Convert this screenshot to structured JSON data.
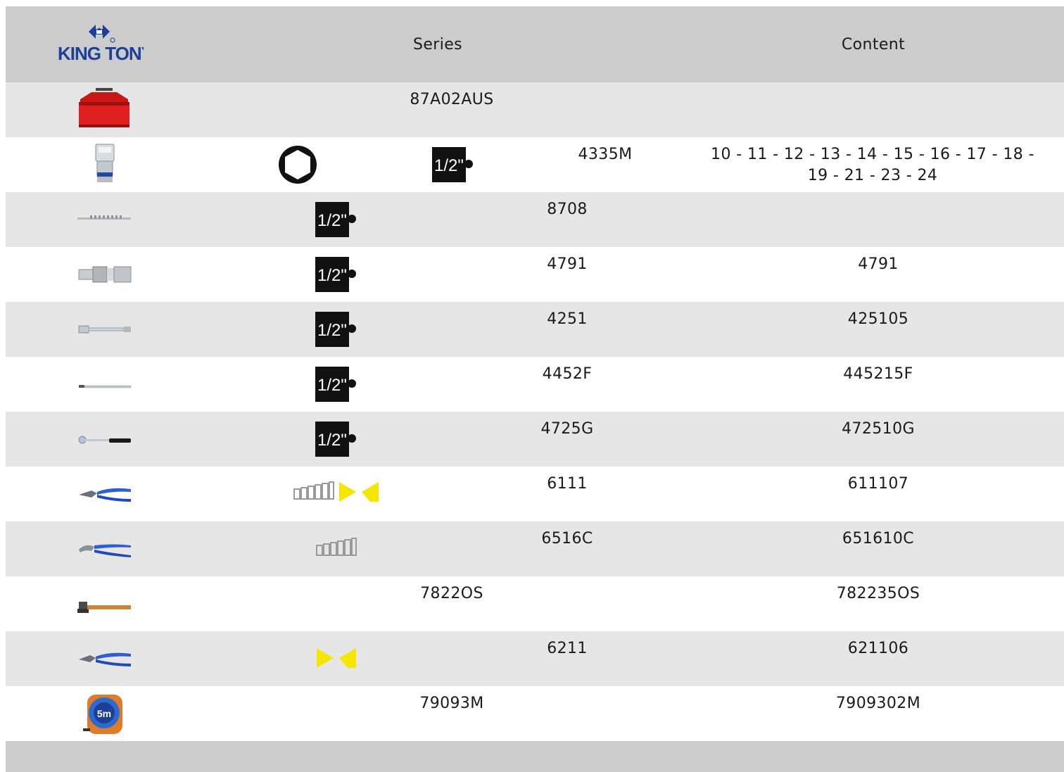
{
  "header": {
    "logo_text": "KING TONY",
    "col_series": "Series",
    "col_content": "Content"
  },
  "rows": [
    {
      "image": "tool-box",
      "series": "87A02AUS",
      "content": ""
    },
    {
      "image": "socket",
      "icons": [
        "hex-icon",
        "half-inch-drive-icon"
      ],
      "series": "4335M",
      "content": "10 - 11 - 12 - 13 - 14 - 15 - 16 - 17 - 18 - 19 - 21 - 23 - 24",
      "content_line1": "10 - 11 - 12 - 13 - 14 - 15 - 16 - 17 - 18 -",
      "content_line2": "19 - 21 - 23 - 24"
    },
    {
      "image": "socket-rail",
      "icons": [
        "half-inch-drive-icon"
      ],
      "series": "8708",
      "content": ""
    },
    {
      "image": "universal-joint",
      "icons": [
        "half-inch-drive-icon"
      ],
      "series": "4791",
      "content": "4791"
    },
    {
      "image": "extension-bar",
      "icons": [
        "half-inch-drive-icon"
      ],
      "series": "4251",
      "content": "425105"
    },
    {
      "image": "flex-handle",
      "icons": [
        "half-inch-drive-icon"
      ],
      "series": "4452F",
      "content": "445215F"
    },
    {
      "image": "ratchet",
      "icons": [
        "half-inch-drive-icon"
      ],
      "series": "4725G",
      "content": "472510G"
    },
    {
      "image": "combination-pliers",
      "icons": [
        "grip-scale-icon",
        "cutter-icon"
      ],
      "series": "6111",
      "content": "611107"
    },
    {
      "image": "water-pump-pliers",
      "icons": [
        "grip-scale-icon"
      ],
      "series": "6516C",
      "content": "651610C"
    },
    {
      "image": "hammer",
      "series": "7822OS",
      "content": "782235OS"
    },
    {
      "image": "diagonal-cutter",
      "icons": [
        "cutter-icon"
      ],
      "series": "6211",
      "content": "621106"
    },
    {
      "image": "measuring-tape",
      "series": "79093M",
      "content": "7909302M",
      "tape_label": "5m"
    }
  ],
  "colors": {
    "header_bg": "#cccccc",
    "row_alt_bg": "#e6e6e6",
    "logo_blue": "#1d3f99",
    "cutter_yellow": "#f5e600"
  }
}
